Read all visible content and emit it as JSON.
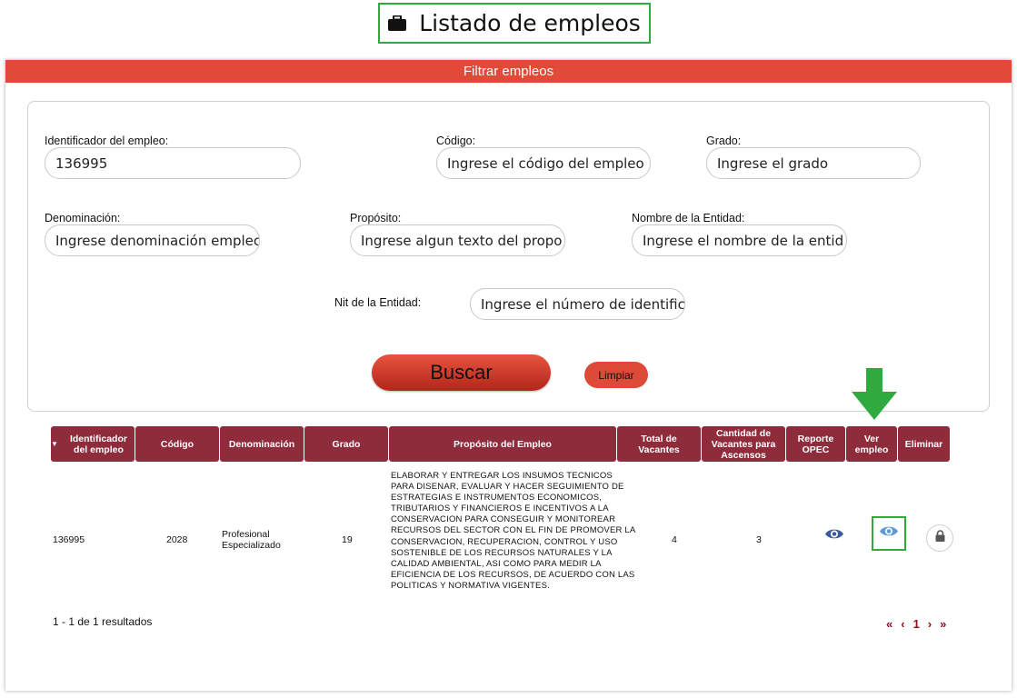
{
  "page_title": "Listado de empleos",
  "filter": {
    "header": "Filtrar empleos",
    "fields": {
      "identificador": {
        "label": "Identificador del empleo:",
        "value": "136995"
      },
      "codigo": {
        "label": "Código:",
        "placeholder": "Ingrese el código del empleo"
      },
      "grado": {
        "label": "Grado:",
        "placeholder": "Ingrese el grado"
      },
      "denominacion": {
        "label": "Denominación:",
        "placeholder": "Ingrese denominación emplec"
      },
      "proposito": {
        "label": "Propósito:",
        "placeholder": "Ingrese algun texto del propo"
      },
      "entidad": {
        "label": "Nombre de la Entidad:",
        "placeholder": "Ingrese el nombre de la entid"
      },
      "nit": {
        "label": "Nit de la Entidad:",
        "placeholder": "Ingrese el número de identific"
      }
    },
    "buscar_label": "Buscar",
    "limpiar_label": "Limpiar"
  },
  "table": {
    "headers": [
      "Identificador del empleo",
      "Código",
      "Denominación",
      "Grado",
      "Propósito del Empleo",
      "Total de Vacantes",
      "Cantidad de Vacantes para Ascensos",
      "Reporte OPEC",
      "Ver empleo",
      "Eliminar"
    ],
    "rows": [
      {
        "identificador": "136995",
        "codigo": "2028",
        "denominacion": "Profesional Especializado",
        "grado": "19",
        "proposito": "ELABORAR Y ENTREGAR LOS INSUMOS TECNICOS PARA DISENAR, EVALUAR Y HACER SEGUIMIENTO DE ESTRATEGIAS E INSTRUMENTOS ECONOMICOS, TRIBUTARIOS Y FINANCIEROS E INCENTIVOS A LA CONSERVACION PARA CONSEGUIR Y MONITOREAR RECURSOS DEL SECTOR CON EL FIN DE PROMOVER LA CONSERVACION, RECUPERACION, CONTROL Y USO SOSTENIBLE DE LOS RECURSOS NATURALES Y LA CALIDAD AMBIENTAL, ASI COMO PARA MEDIR LA EFICIENCIA DE LOS RECURSOS, DE ACUERDO CON LAS POLITICAS Y NORMATIVA VIGENTES.",
        "total_vacantes": "4",
        "vacantes_ascensos": "3",
        "reporte_icon": "eye-icon",
        "ver_icon": "eye-icon",
        "eliminar_icon": "lock-icon"
      }
    ]
  },
  "results_text": "1 - 1 de 1 resultados",
  "pager": {
    "first": "«",
    "prev": "‹",
    "current": "1",
    "next": "›",
    "last": "»"
  },
  "colors": {
    "header_bar": "#e04a38",
    "table_header": "#8e2c3c",
    "highlight": "#2eaa3f",
    "eye_dark": "#3a5a98",
    "eye_light": "#5b9bd5"
  }
}
